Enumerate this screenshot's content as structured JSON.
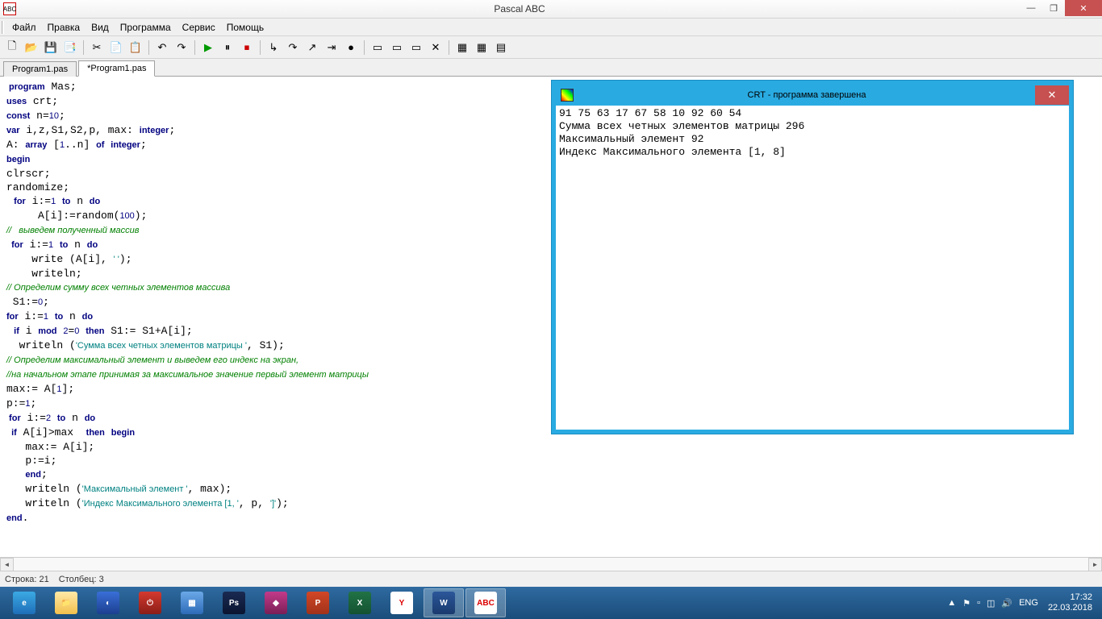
{
  "window": {
    "title": "Pascal ABC",
    "app_icon_text": "ABC"
  },
  "win_buttons": {
    "min": "—",
    "max": "❐",
    "close": "✕"
  },
  "menu": [
    "Файл",
    "Правка",
    "Вид",
    "Программа",
    "Сервис",
    "Помощь"
  ],
  "toolbar_icons": [
    {
      "name": "new-file-icon",
      "glyph": "🗋"
    },
    {
      "name": "open-file-icon",
      "glyph": "📂"
    },
    {
      "name": "save-icon",
      "glyph": "💾"
    },
    {
      "name": "save-all-icon",
      "glyph": "📑"
    },
    {
      "name": "sep"
    },
    {
      "name": "cut-icon",
      "glyph": "✂"
    },
    {
      "name": "copy-icon",
      "glyph": "📄"
    },
    {
      "name": "paste-icon",
      "glyph": "📋"
    },
    {
      "name": "sep"
    },
    {
      "name": "undo-icon",
      "glyph": "↶"
    },
    {
      "name": "redo-icon",
      "glyph": "↷"
    },
    {
      "name": "sep"
    },
    {
      "name": "run-icon",
      "glyph": "▶"
    },
    {
      "name": "pause-icon",
      "glyph": "⏸"
    },
    {
      "name": "stop-icon",
      "glyph": "⏹"
    },
    {
      "name": "sep"
    },
    {
      "name": "step-into-icon",
      "glyph": "↳"
    },
    {
      "name": "step-over-icon",
      "glyph": "↷"
    },
    {
      "name": "step-out-icon",
      "glyph": "↗"
    },
    {
      "name": "run-to-cursor-icon",
      "glyph": "⇥"
    },
    {
      "name": "breakpoint-icon",
      "glyph": "●"
    },
    {
      "name": "sep"
    },
    {
      "name": "watch-icon",
      "glyph": "▭"
    },
    {
      "name": "locals-icon",
      "glyph": "▭"
    },
    {
      "name": "output-icon",
      "glyph": "▭"
    },
    {
      "name": "close-panel-icon",
      "glyph": "✕"
    },
    {
      "name": "sep"
    },
    {
      "name": "design-icon",
      "glyph": "▦"
    },
    {
      "name": "form-icon",
      "glyph": "▦"
    },
    {
      "name": "props-icon",
      "glyph": "▤"
    }
  ],
  "tabs": [
    {
      "label": "Program1.pas",
      "active": false
    },
    {
      "label": "*Program1.pas",
      "active": true
    }
  ],
  "status": {
    "line_label": "Строка:",
    "line": "21",
    "col_label": "Столбец:",
    "col": "3"
  },
  "crt": {
    "title": "CRT - программа завершена",
    "output": "91 75 63 17 67 58 10 92 60 54\nСумма всех четных элементов матрицы 296\nМаксимальный элемент 92\nИндекс Максимального элемента [1, 8]"
  },
  "code": {
    "l1a": " program",
    "l1b": " Mas;",
    "l2a": "uses",
    "l2b": " crt;",
    "l3a": "const",
    "l3b": " n=",
    "l3c": "10",
    "l3d": ";",
    "l4a": "var",
    "l4b": " i,z,S1,S2,p, max: ",
    "l4c": "integer",
    "l4d": ";",
    "l5a": "A: ",
    "l5b": "array",
    "l5c": " [",
    "l5d": "1",
    "l5e": "..n] ",
    "l5f": "of",
    "l5g": " ",
    "l5h": "integer",
    "l5i": ";",
    "l6": "begin",
    "l7": "clrscr;",
    "l8": "randomize;",
    "l9a": "   for",
    "l9b": " i:=",
    "l9c": "1",
    "l9d": " ",
    "l9e": "to",
    "l9f": " n ",
    "l9g": "do",
    "l10a": "     A[i]:=random(",
    "l10b": "100",
    "l10c": ");",
    "l11": "//   выведем полученный массив",
    "l12a": "  for",
    "l12b": " i:=",
    "l12c": "1",
    "l12d": " ",
    "l12e": "to",
    "l12f": " n ",
    "l12g": "do",
    "l13a": "    write (A[i], ",
    "l13b": "' '",
    "l13c": ");",
    "l14": "    writeln;",
    "l15": "// Определим сумму всех четных элементов массива",
    "l16a": " S1:=",
    "l16b": "0",
    "l16c": ";",
    "l17a": "for",
    "l17b": " i:=",
    "l17c": "1",
    "l17d": " ",
    "l17e": "to",
    "l17f": " n ",
    "l17g": "do",
    "l18a": "   if",
    "l18b": " i ",
    "l18c": "mod",
    "l18d": " ",
    "l18e": "2",
    "l18f": "=",
    "l18g": "0",
    "l18h": " ",
    "l18i": "then",
    "l18j": " S1:= S1+A[i];",
    "l19a": "  writeln (",
    "l19b": "'Сумма всех четных элементов матрицы '",
    "l19c": ", S1);",
    "l20": "// Определим максимальный элемент и выведем его индекс на экран,",
    "l21": "//на начальном этапе принимая за максимальное значение первый элемент матрицы",
    "l22a": "max:= A[",
    "l22b": "1",
    "l22c": "];",
    "l23a": "p:=",
    "l23b": "1",
    "l23c": ";",
    "l24a": " for",
    "l24b": " i:=",
    "l24c": "2",
    "l24d": " ",
    "l24e": "to",
    "l24f": " n ",
    "l24g": "do",
    "l25a": "  if",
    "l25b": " A[i]>max  ",
    "l25c": "then",
    "l25d": " ",
    "l25e": "begin",
    "l26": "   max:= A[i];",
    "l27": "   p:=i;",
    "l28a": "   ",
    "l28b": "end",
    "l28c": ";",
    "l29a": "   writeln (",
    "l29b": "'Максимальный элемент '",
    "l29c": ", max);",
    "l30a": "   writeln (",
    "l30b": "'Индекс Максимального элемента [1, '",
    "l30c": ", p, ",
    "l30d": "']'",
    "l30e": ");",
    "l31a": "end",
    "l31b": "."
  },
  "taskbar": {
    "apps": [
      {
        "name": "ie-icon",
        "bg": "linear-gradient(#3ba9e4,#1e6fb8)",
        "glyph": "e"
      },
      {
        "name": "explorer-icon",
        "bg": "linear-gradient(#ffe9a8,#f2c04c)",
        "glyph": "📁"
      },
      {
        "name": "app-icon-1",
        "bg": "linear-gradient(#3a6fd8,#1c3f8f)",
        "glyph": "◐"
      },
      {
        "name": "app-icon-2",
        "bg": "linear-gradient(#d43a2f,#8a1e17)",
        "glyph": "⏻"
      },
      {
        "name": "app-icon-3",
        "bg": "linear-gradient(#6aa8e8,#2e6bb8)",
        "glyph": "▦"
      },
      {
        "name": "photoshop-icon",
        "bg": "linear-gradient(#1a2a52,#0a1530)",
        "glyph": "Ps"
      },
      {
        "name": "app-icon-4",
        "bg": "linear-gradient(#c23a8a,#7a1f56)",
        "glyph": "◆"
      },
      {
        "name": "powerpoint-icon",
        "bg": "linear-gradient(#d24726,#a0321a)",
        "glyph": "P"
      },
      {
        "name": "excel-icon",
        "bg": "linear-gradient(#217346,#145232)",
        "glyph": "X"
      },
      {
        "name": "yandex-icon",
        "bg": "#fff",
        "glyph": "Y"
      },
      {
        "name": "word-icon",
        "bg": "linear-gradient(#2b579a,#1a3a6e)",
        "glyph": "W",
        "active": true
      },
      {
        "name": "pascal-icon",
        "bg": "#fff",
        "glyph": "ABC",
        "active": true
      }
    ],
    "tray": {
      "lang": "ENG",
      "time": "17:32",
      "date": "22.03.2018"
    }
  }
}
